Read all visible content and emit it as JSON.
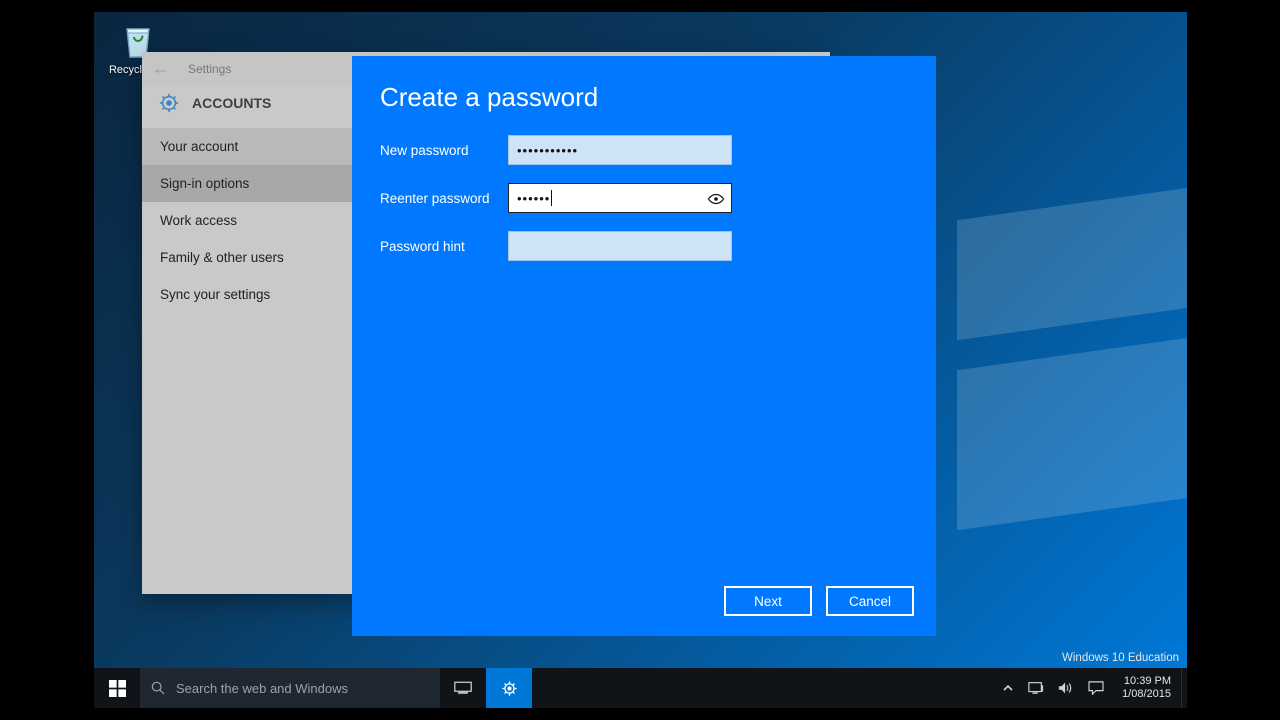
{
  "desktop": {
    "recycle_bin_label": "Recycle Bin"
  },
  "settings": {
    "header_back": "←",
    "header_title": "Settings",
    "section_title": "ACCOUNTS",
    "items": [
      {
        "label": "Your account",
        "state": "hover"
      },
      {
        "label": "Sign-in options",
        "state": "active"
      },
      {
        "label": "Work access",
        "state": ""
      },
      {
        "label": "Family & other users",
        "state": ""
      },
      {
        "label": "Sync your settings",
        "state": ""
      }
    ]
  },
  "modal": {
    "title": "Create a password",
    "rows": {
      "new_password": {
        "label": "New password",
        "value": "•••••••••••"
      },
      "reenter_password": {
        "label": "Reenter password",
        "value": "••••••"
      },
      "password_hint": {
        "label": "Password hint",
        "value": ""
      }
    },
    "buttons": {
      "next": "Next",
      "cancel": "Cancel"
    }
  },
  "watermark": "Windows 10 Education",
  "taskbar": {
    "search_placeholder": "Search the web and Windows",
    "clock_time": "10:39 PM",
    "clock_date": "1/08/2015"
  }
}
